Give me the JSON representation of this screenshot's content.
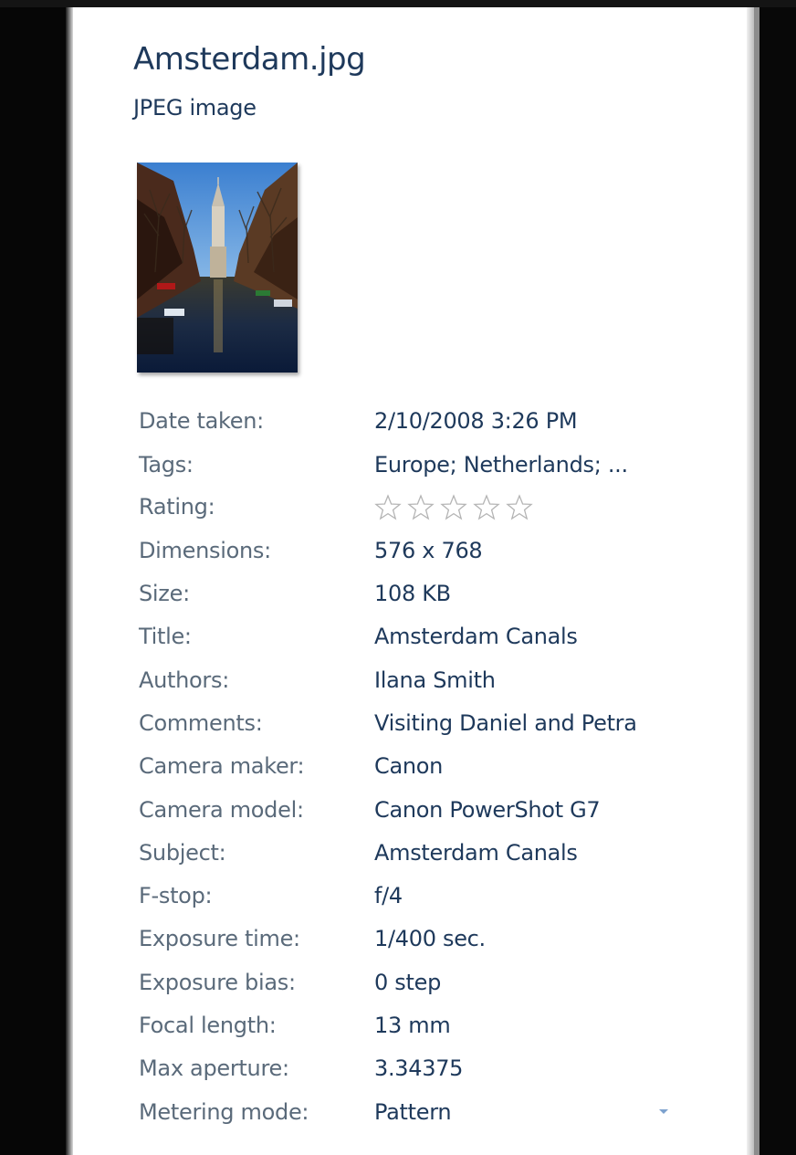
{
  "file": {
    "name": "Amsterdam.jpg",
    "type": "JPEG image"
  },
  "thumbnail": {
    "icon": "photo-thumbnail"
  },
  "properties": [
    {
      "label": "Date taken:",
      "value": "2/10/2008 3:26 PM"
    },
    {
      "label": "Tags:",
      "value": "Europe; Netherlands; ..."
    },
    {
      "label": "Rating:",
      "value": "",
      "rating": 0,
      "max_rating": 5
    },
    {
      "label": "Dimensions:",
      "value": "576 x 768"
    },
    {
      "label": "Size:",
      "value": "108 KB"
    },
    {
      "label": "Title:",
      "value": "Amsterdam Canals"
    },
    {
      "label": "Authors:",
      "value": "Ilana Smith"
    },
    {
      "label": "Comments:",
      "value": "Visiting Daniel and Petra"
    },
    {
      "label": "Camera maker:",
      "value": "Canon"
    },
    {
      "label": "Camera model:",
      "value": "Canon PowerShot G7"
    },
    {
      "label": "Subject:",
      "value": "Amsterdam Canals"
    },
    {
      "label": "F-stop:",
      "value": "f/4"
    },
    {
      "label": "Exposure time:",
      "value": "1/400 sec."
    },
    {
      "label": "Exposure bias:",
      "value": "0 step"
    },
    {
      "label": "Focal length:",
      "value": "13 mm"
    },
    {
      "label": "Max aperture:",
      "value": "3.34375"
    },
    {
      "label": "Metering mode:",
      "value": "Pattern"
    }
  ],
  "colors": {
    "label": "#5a6a7a",
    "value": "#1e395b",
    "star_outline": "#b4b4b4",
    "dropdown_arrow": "#7da2ce"
  }
}
